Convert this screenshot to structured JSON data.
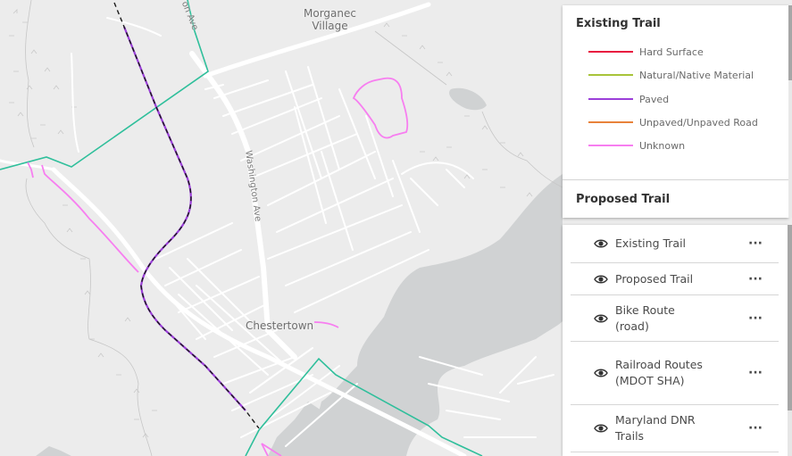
{
  "map": {
    "labels": {
      "morganec": "Morganec\nVillage",
      "morganec_line1": "Morganec",
      "morganec_line2": "Village",
      "chestertown": "Chestertown",
      "washington_ave": "Washington Ave",
      "gordon_ave": "on Ave"
    },
    "colors": {
      "land": "#ececec",
      "water": "#d0d2d3",
      "road": "#ffffff",
      "bike_route": "#2fbf9b",
      "railroad": "#1a1a1a",
      "wetland_symbol": "#c8c8c8"
    }
  },
  "legend": {
    "existing_trail_title": "Existing Trail",
    "items": [
      {
        "label": "Hard Surface",
        "color": "#e8173f"
      },
      {
        "label": "Natural/Native Material",
        "color": "#a8c43a"
      },
      {
        "label": "Paved",
        "color": "#9b3fd9"
      },
      {
        "label": "Unpaved/Unpaved Road",
        "color": "#e8823a"
      },
      {
        "label": "Unknown",
        "color": "#f77ef0"
      }
    ],
    "proposed_trail_title": "Proposed Trail"
  },
  "layer_list": {
    "layers": [
      {
        "label": "Existing Trail",
        "visible": true,
        "icon": "eye-icon",
        "menu_icon": "ellipsis-icon"
      },
      {
        "label": "Proposed Trail",
        "visible": true,
        "icon": "eye-icon",
        "menu_icon": "ellipsis-icon"
      },
      {
        "label": "Bike Route (road)",
        "visible": true,
        "icon": "eye-icon",
        "menu_icon": "ellipsis-icon"
      },
      {
        "label": "Railroad Routes (MDOT SHA)",
        "visible": true,
        "icon": "eye-icon",
        "menu_icon": "ellipsis-icon"
      },
      {
        "label": "Maryland DNR Trails",
        "visible": true,
        "icon": "eye-icon",
        "menu_icon": "ellipsis-icon"
      }
    ],
    "more_glyph": "···"
  }
}
